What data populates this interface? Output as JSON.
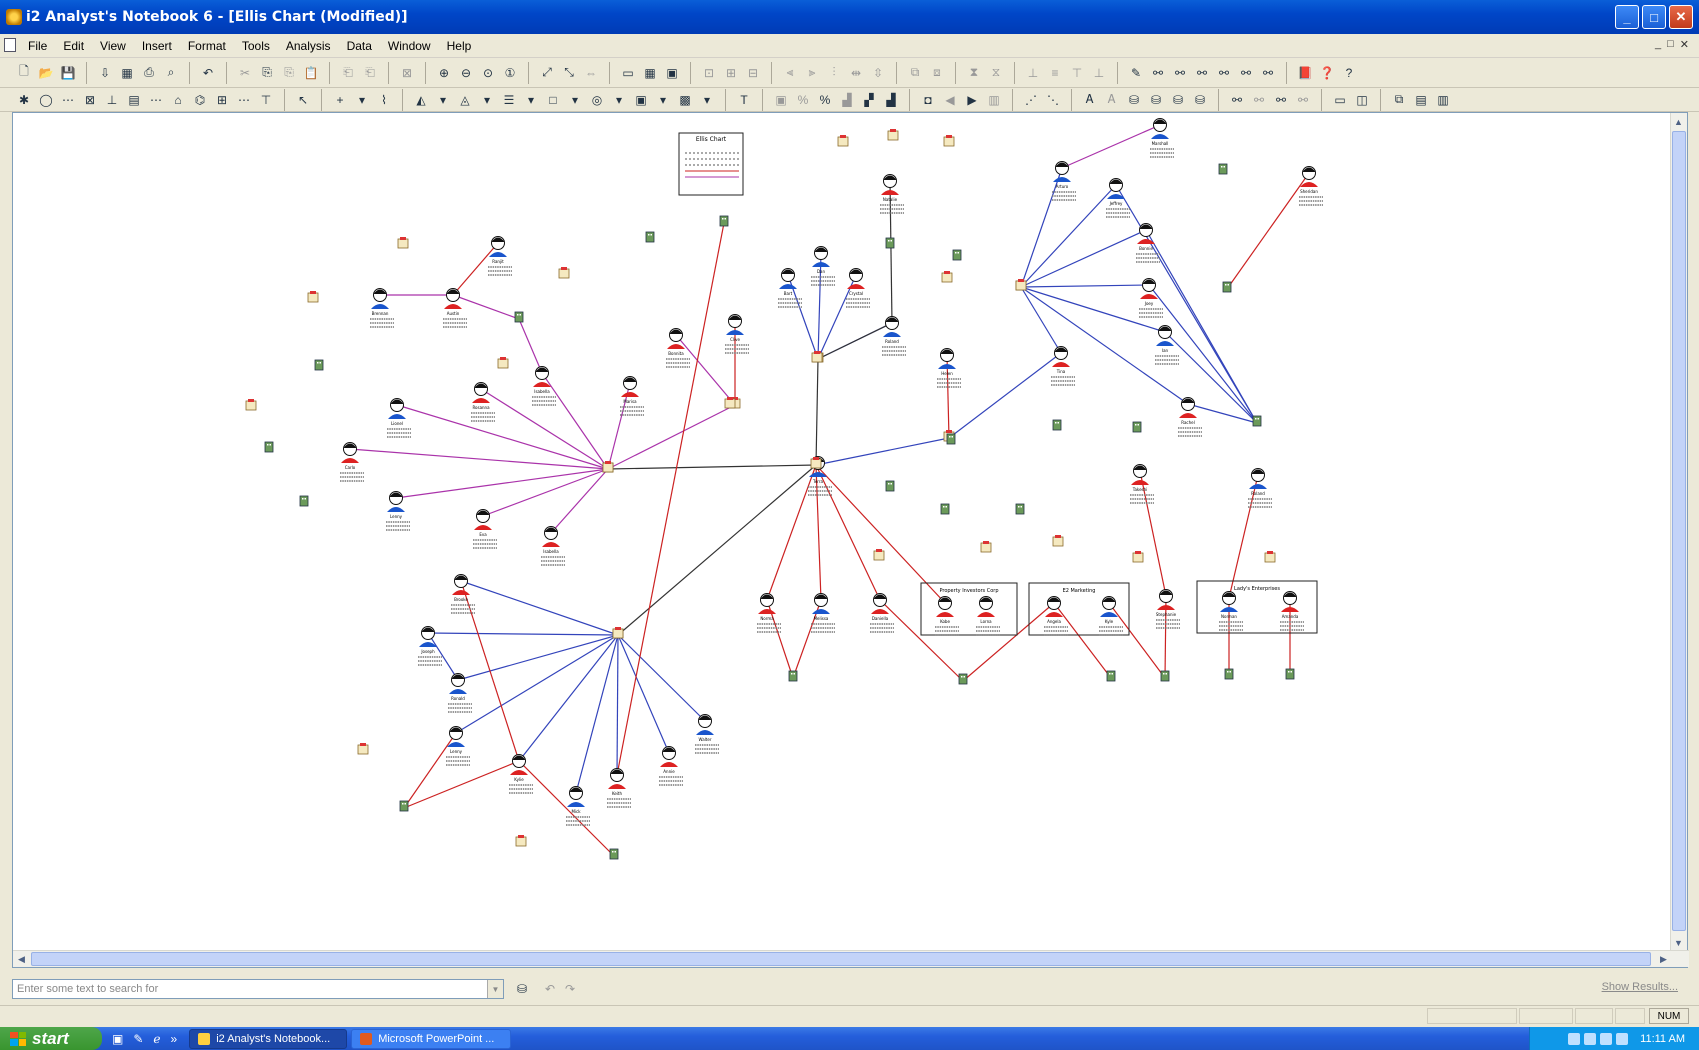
{
  "window": {
    "title": "i2 Analyst's Notebook 6 - [Ellis Chart (Modified)]",
    "min": "_",
    "max": "□",
    "close": "✕"
  },
  "menu": [
    "File",
    "Edit",
    "View",
    "Insert",
    "Format",
    "Tools",
    "Analysis",
    "Data",
    "Window",
    "Help"
  ],
  "mdi_controls": [
    "_",
    "□",
    "✕"
  ],
  "toolbar1": [
    {
      "icon": "new-icon",
      "glyph": "🗋"
    },
    {
      "icon": "open-icon",
      "glyph": "📂"
    },
    {
      "icon": "save-icon",
      "glyph": "💾"
    },
    {
      "icon": "sep"
    },
    {
      "icon": "import-icon",
      "glyph": "⇩"
    },
    {
      "icon": "chart-properties-icon",
      "glyph": "▦"
    },
    {
      "icon": "print-icon",
      "glyph": "⎙"
    },
    {
      "icon": "print-preview-icon",
      "glyph": "⌕"
    },
    {
      "icon": "sep"
    },
    {
      "icon": "undo-icon",
      "glyph": "↶"
    },
    {
      "icon": "sep"
    },
    {
      "icon": "cut-icon",
      "glyph": "✂",
      "dim": true
    },
    {
      "icon": "copy-icon",
      "glyph": "⎘"
    },
    {
      "icon": "copy-special-icon",
      "glyph": "⎘",
      "dim": true
    },
    {
      "icon": "paste-icon",
      "glyph": "📋"
    },
    {
      "icon": "sep"
    },
    {
      "icon": "paste-special-icon",
      "glyph": "⎗",
      "dim": true
    },
    {
      "icon": "paste-format-icon",
      "glyph": "⎗",
      "dim": true
    },
    {
      "icon": "sep"
    },
    {
      "icon": "delete-icon",
      "glyph": "⊠",
      "dim": true
    },
    {
      "icon": "sep"
    },
    {
      "icon": "zoom-in-icon",
      "glyph": "⊕"
    },
    {
      "icon": "zoom-out-icon",
      "glyph": "⊖"
    },
    {
      "icon": "zoom-area-icon",
      "glyph": "⊙"
    },
    {
      "icon": "zoom-100-icon",
      "glyph": "①"
    },
    {
      "icon": "sep"
    },
    {
      "icon": "fit-window-icon",
      "glyph": "⤢"
    },
    {
      "icon": "fit-selection-icon",
      "glyph": "⤡"
    },
    {
      "icon": "fit-width-icon",
      "glyph": "⇔",
      "dim": true
    },
    {
      "icon": "sep"
    },
    {
      "icon": "chart-window-icon",
      "glyph": "▭"
    },
    {
      "icon": "grid-icon",
      "glyph": "▦"
    },
    {
      "icon": "overview-icon",
      "glyph": "▣"
    },
    {
      "icon": "sep"
    },
    {
      "icon": "lock-icon",
      "glyph": "⊡",
      "dim": true
    },
    {
      "icon": "layout-a-icon",
      "glyph": "⊞",
      "dim": true
    },
    {
      "icon": "layout-b-icon",
      "glyph": "⊟",
      "dim": true
    },
    {
      "icon": "sep"
    },
    {
      "icon": "align-left-icon",
      "glyph": "⫷",
      "dim": true
    },
    {
      "icon": "align-center-icon",
      "glyph": "⫸",
      "dim": true
    },
    {
      "icon": "align-right-icon",
      "glyph": "⫶",
      "dim": true
    },
    {
      "icon": "distribute-h-icon",
      "glyph": "⇹",
      "dim": true
    },
    {
      "icon": "distribute-v-icon",
      "glyph": "⇳",
      "dim": true
    },
    {
      "icon": "sep"
    },
    {
      "icon": "group-icon",
      "glyph": "⧉",
      "dim": true
    },
    {
      "icon": "ungroup-icon",
      "glyph": "⧈",
      "dim": true
    },
    {
      "icon": "sep"
    },
    {
      "icon": "arrange-icon",
      "glyph": "⧗",
      "dim": true
    },
    {
      "icon": "spacing-icon",
      "glyph": "⧖",
      "dim": true
    },
    {
      "icon": "sep"
    },
    {
      "icon": "snap-icon",
      "glyph": "⊥",
      "dim": true
    },
    {
      "icon": "link-style-icon",
      "glyph": "≡",
      "dim": true
    },
    {
      "icon": "bring-front-icon",
      "glyph": "⊤",
      "dim": true
    },
    {
      "icon": "send-back-icon",
      "glyph": "⊥",
      "dim": true
    },
    {
      "icon": "sep"
    },
    {
      "icon": "wand-icon",
      "glyph": "✎"
    },
    {
      "icon": "layout-1-icon",
      "glyph": "⚯"
    },
    {
      "icon": "layout-2-icon",
      "glyph": "⚯"
    },
    {
      "icon": "layout-3-icon",
      "glyph": "⚯"
    },
    {
      "icon": "layout-4-icon",
      "glyph": "⚯"
    },
    {
      "icon": "layout-5-icon",
      "glyph": "⚯"
    },
    {
      "icon": "layout-6-icon",
      "glyph": "⚯"
    },
    {
      "icon": "sep"
    },
    {
      "icon": "book-icon",
      "glyph": "📕"
    },
    {
      "icon": "whats-this-icon",
      "glyph": "❓"
    },
    {
      "icon": "help-icon",
      "glyph": "?"
    }
  ],
  "toolbar2": [
    {
      "icon": "new-entity-icon",
      "glyph": "✱"
    },
    {
      "icon": "circle-entity-icon",
      "glyph": "◯"
    },
    {
      "icon": "link-icon",
      "glyph": "⋯"
    },
    {
      "icon": "box-icon",
      "glyph": "⊠"
    },
    {
      "icon": "theme-line-icon",
      "glyph": "⊥"
    },
    {
      "icon": "event-frame-icon",
      "glyph": "▤"
    },
    {
      "icon": "timeline-icon",
      "glyph": "⋯"
    },
    {
      "icon": "network-icon",
      "glyph": "⌂"
    },
    {
      "icon": "label-icon",
      "glyph": "⌬"
    },
    {
      "icon": "table-icon",
      "glyph": "⊞"
    },
    {
      "icon": "dashed-line-icon",
      "glyph": "⋯"
    },
    {
      "icon": "bar-icon",
      "glyph": "⊤"
    },
    {
      "icon": "sep"
    },
    {
      "icon": "select-pointer-icon",
      "glyph": "↖"
    },
    {
      "icon": "sep"
    },
    {
      "icon": "add-icon",
      "glyph": "+"
    },
    {
      "icon": "dropdown-icon",
      "glyph": "▾"
    },
    {
      "icon": "connect-icon",
      "glyph": "⌇"
    },
    {
      "icon": "sep"
    },
    {
      "icon": "fill-color-icon",
      "glyph": "◭"
    },
    {
      "icon": "dropdown-icon",
      "glyph": "▾"
    },
    {
      "icon": "line-color-icon",
      "glyph": "◬"
    },
    {
      "icon": "dropdown-icon",
      "glyph": "▾"
    },
    {
      "icon": "line-style-icon",
      "glyph": "☰"
    },
    {
      "icon": "dropdown-icon",
      "glyph": "▾"
    },
    {
      "icon": "frame-icon",
      "glyph": "□"
    },
    {
      "icon": "dropdown-icon",
      "glyph": "▾"
    },
    {
      "icon": "shape-icon",
      "glyph": "◎"
    },
    {
      "icon": "dropdown-icon",
      "glyph": "▾"
    },
    {
      "icon": "picture-icon",
      "glyph": "▣"
    },
    {
      "icon": "dropdown-icon",
      "glyph": "▾"
    },
    {
      "icon": "image-icon",
      "glyph": "▩"
    },
    {
      "icon": "dropdown-icon",
      "glyph": "▾"
    },
    {
      "icon": "sep"
    },
    {
      "icon": "text-icon",
      "glyph": "T"
    },
    {
      "icon": "sep"
    },
    {
      "icon": "chart-snapshot-icon",
      "glyph": "▣",
      "dim": true
    },
    {
      "icon": "percent-a-icon",
      "glyph": "%",
      "dim": true
    },
    {
      "icon": "percent-b-icon",
      "glyph": "%"
    },
    {
      "icon": "histogram-a-icon",
      "glyph": "▟",
      "dim": true
    },
    {
      "icon": "histogram-b-icon",
      "glyph": "▞"
    },
    {
      "icon": "histogram-c-icon",
      "glyph": "▟"
    },
    {
      "icon": "sep"
    },
    {
      "icon": "camera-icon",
      "glyph": "◘"
    },
    {
      "icon": "back-icon",
      "glyph": "◀",
      "dim": true
    },
    {
      "icon": "play-icon",
      "glyph": "▶"
    },
    {
      "icon": "step-icon",
      "glyph": "▥",
      "dim": true
    },
    {
      "icon": "sep"
    },
    {
      "icon": "link-analysis-a-icon",
      "glyph": "⋰"
    },
    {
      "icon": "link-analysis-b-icon",
      "glyph": "⋱"
    },
    {
      "icon": "sep"
    },
    {
      "icon": "text-style-a-icon",
      "glyph": "Ꭺ"
    },
    {
      "icon": "text-style-b-icon",
      "glyph": "Ꭺ",
      "dim": true
    },
    {
      "icon": "find-a-icon",
      "glyph": "⛁"
    },
    {
      "icon": "find-b-icon",
      "glyph": "⛁"
    },
    {
      "icon": "find-c-icon",
      "glyph": "⛁"
    },
    {
      "icon": "find-d-icon",
      "glyph": "⛁"
    },
    {
      "icon": "sep"
    },
    {
      "icon": "path-a-icon",
      "glyph": "⚯"
    },
    {
      "icon": "path-b-icon",
      "glyph": "⚯",
      "dim": true
    },
    {
      "icon": "path-c-icon",
      "glyph": "⚯"
    },
    {
      "icon": "path-d-icon",
      "glyph": "⚯",
      "dim": true
    },
    {
      "icon": "sep"
    },
    {
      "icon": "window-single-icon",
      "glyph": "▭"
    },
    {
      "icon": "window-split-icon",
      "glyph": "◫"
    },
    {
      "icon": "sep"
    },
    {
      "icon": "window-cascade-icon",
      "glyph": "⧉"
    },
    {
      "icon": "window-tile-h-icon",
      "glyph": "▤"
    },
    {
      "icon": "window-tile-v-icon",
      "glyph": "▥"
    }
  ],
  "chart": {
    "title_box": "Ellis Chart",
    "people": [
      {
        "label": "Marshall",
        "gender": "m"
      },
      {
        "label": "Arturo",
        "gender": "m"
      },
      {
        "label": "Jeffrey",
        "gender": "m"
      },
      {
        "label": "Sheridan",
        "gender": "f"
      },
      {
        "label": "Bonnie",
        "gender": "f"
      },
      {
        "label": "Joey",
        "gender": "f"
      },
      {
        "label": "Ian",
        "gender": "m"
      },
      {
        "label": "Rachel",
        "gender": "f"
      },
      {
        "label": "Tina",
        "gender": "f"
      },
      {
        "label": "Isabella",
        "gender": "f"
      },
      {
        "label": "Dan",
        "gender": "m"
      },
      {
        "label": "Crystal",
        "gender": "f"
      },
      {
        "label": "Roland",
        "gender": "m"
      },
      {
        "label": "Bart",
        "gender": "m"
      },
      {
        "label": "Helen",
        "gender": "m"
      },
      {
        "label": "Clive",
        "gender": "m"
      },
      {
        "label": "Bonnita",
        "gender": "f"
      },
      {
        "label": "Lionel",
        "gender": "m"
      },
      {
        "label": "Marisa",
        "gender": "f"
      },
      {
        "label": "Ranjit",
        "gender": "m"
      },
      {
        "label": "Austin",
        "gender": "f"
      },
      {
        "label": "Brennan",
        "gender": "m"
      },
      {
        "label": "Rosanna",
        "gender": "f"
      },
      {
        "label": "Carlo",
        "gender": "f"
      },
      {
        "label": "Lenny",
        "gender": "m"
      },
      {
        "label": "Eva",
        "gender": "f"
      },
      {
        "label": "Isabella",
        "gender": "f"
      },
      {
        "label": "Brooke",
        "gender": "f"
      },
      {
        "label": "Joseph",
        "gender": "m"
      },
      {
        "label": "Ronald",
        "gender": "m"
      },
      {
        "label": "Lenny",
        "gender": "m"
      },
      {
        "label": "Kylie",
        "gender": "f"
      },
      {
        "label": "Mick",
        "gender": "m"
      },
      {
        "label": "Keith",
        "gender": "f"
      },
      {
        "label": "Annie",
        "gender": "f"
      },
      {
        "label": "Walter",
        "gender": "m"
      },
      {
        "label": "Natalie",
        "gender": "f"
      },
      {
        "label": "Norma",
        "gender": "f"
      },
      {
        "label": "Melissa",
        "gender": "m"
      },
      {
        "label": "Daniella",
        "gender": "f"
      },
      {
        "label": "Kobe",
        "gender": "f"
      },
      {
        "label": "Lorna",
        "gender": "f"
      },
      {
        "label": "Angela",
        "gender": "f"
      },
      {
        "label": "Kyle",
        "gender": "m"
      },
      {
        "label": "Takeshi",
        "gender": "f"
      },
      {
        "label": "Stephanie",
        "gender": "f"
      },
      {
        "label": "Roland",
        "gender": "m"
      },
      {
        "label": "Norman",
        "gender": "m"
      },
      {
        "label": "Amanda",
        "gender": "f"
      },
      {
        "label": "Terra",
        "gender": "m"
      }
    ],
    "groups": [
      "Property Investors Corp",
      "E2 Marketing",
      "Lady's Enterprises"
    ]
  },
  "search": {
    "placeholder": "Enter some text to search for",
    "show_results": "Show Results..."
  },
  "status": {
    "num": "NUM"
  },
  "taskbar": {
    "start": "start",
    "quicklaunch": [
      "desktop-icon",
      "messenger-icon",
      "ie-icon"
    ],
    "more": "»",
    "tasks": [
      {
        "label": "i2 Analyst's Notebook...",
        "active": true
      },
      {
        "label": "Microsoft PowerPoint ...",
        "active": false
      }
    ],
    "clock": "11:11 AM"
  },
  "colors": {
    "link_blue": "#3344bb",
    "link_red": "#cc2222",
    "link_purple": "#aa33aa",
    "link_black": "#333333",
    "male_shirt": "#1a55cc",
    "female_shirt": "#dd2222",
    "face": "#ffffff",
    "accent": "#0a5fd8"
  }
}
